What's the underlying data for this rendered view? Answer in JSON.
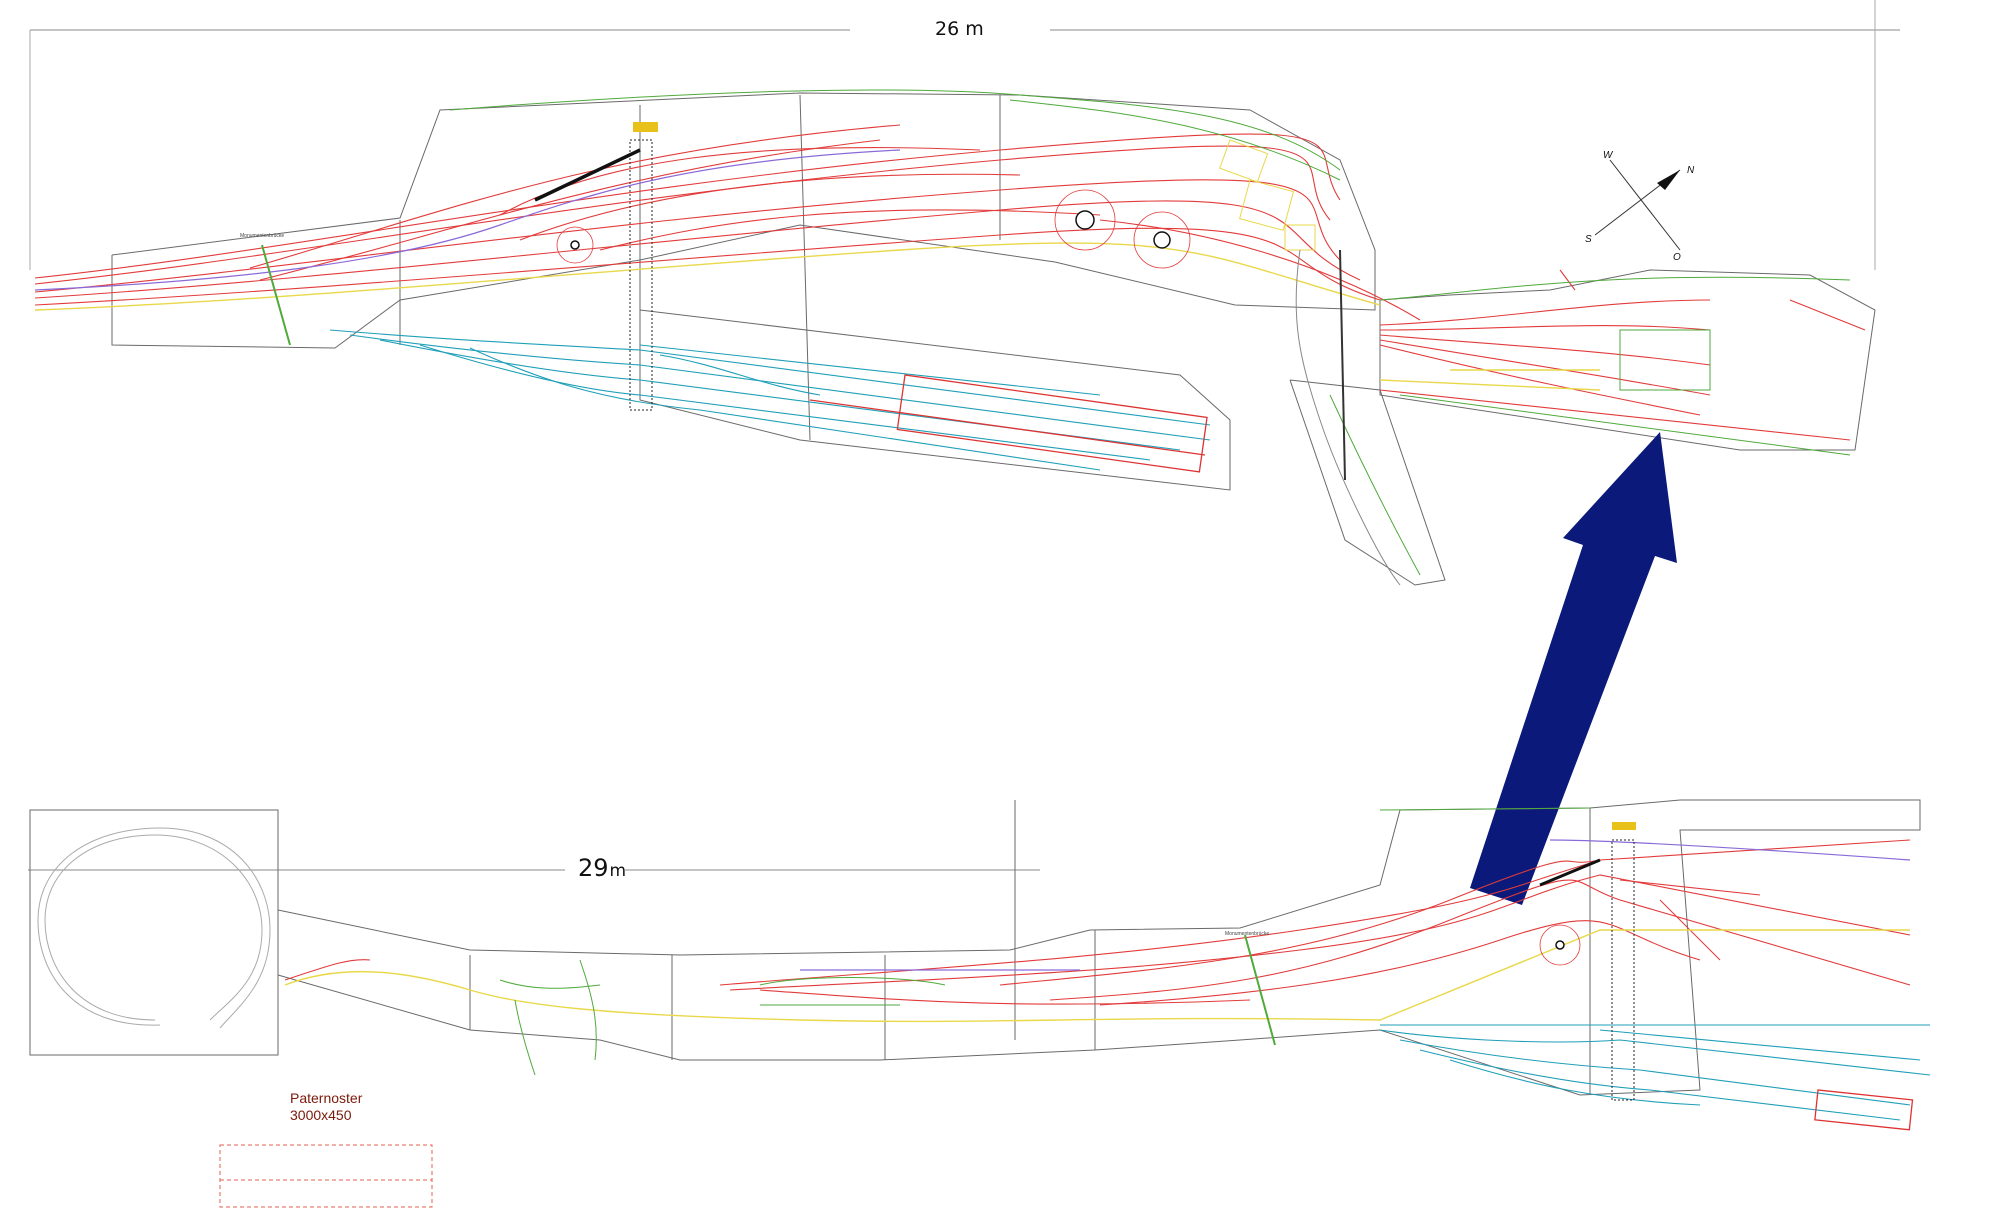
{
  "dimensions": {
    "top_length": "26 m",
    "bottom_length_value": "29",
    "bottom_length_unit": "m"
  },
  "compass": {
    "north": "N",
    "south": "S",
    "west": "W",
    "east": "O"
  },
  "legend": {
    "title": "Paternoster",
    "size": "3000x450"
  },
  "labels": {
    "bridge_top": "Monumentenbrücke",
    "bridge_bottom": "Monumentenbrücke"
  },
  "colors": {
    "main_track": "#e23b3b",
    "yard_track": "#1f9fb8",
    "sbahn_track": "#e8d84a",
    "green_track": "#4faa3c",
    "violet_track": "#8a6ad8",
    "outline": "#6a6a6a",
    "arrow": "#0b1a7a"
  }
}
